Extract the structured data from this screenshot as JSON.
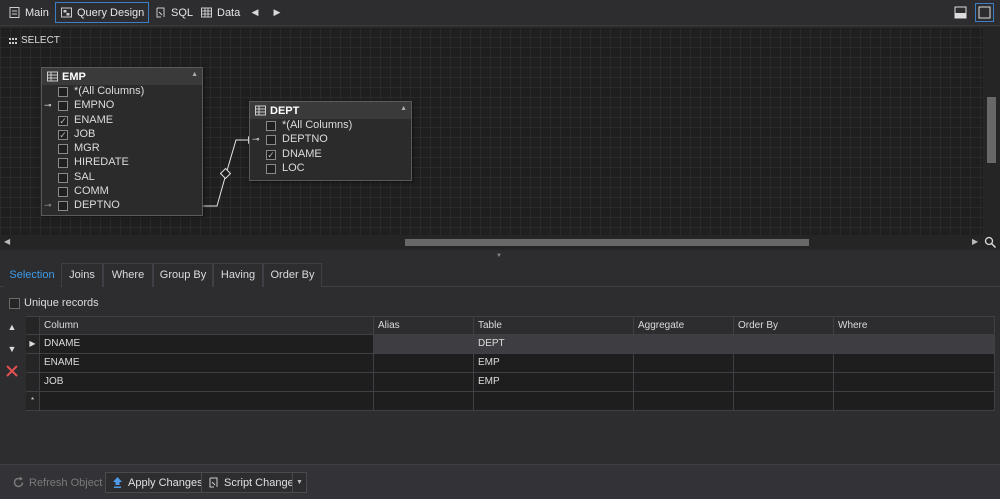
{
  "toolbar": {
    "tabs": [
      {
        "label": "Main",
        "icon": "document-icon"
      },
      {
        "label": "Query Design",
        "icon": "query-design-icon",
        "active": true
      },
      {
        "label": "SQL",
        "icon": "sql-icon"
      },
      {
        "label": "Data",
        "icon": "grid-icon"
      }
    ]
  },
  "designer": {
    "select_label": "SELECT",
    "tables": [
      {
        "name": "EMP",
        "columns": [
          {
            "label": "*(All Columns)",
            "checked": false,
            "key": ""
          },
          {
            "label": "EMPNO",
            "checked": false,
            "key": "primary"
          },
          {
            "label": "ENAME",
            "checked": true,
            "key": ""
          },
          {
            "label": "JOB",
            "checked": true,
            "key": ""
          },
          {
            "label": "MGR",
            "checked": false,
            "key": ""
          },
          {
            "label": "HIREDATE",
            "checked": false,
            "key": ""
          },
          {
            "label": "SAL",
            "checked": false,
            "key": ""
          },
          {
            "label": "COMM",
            "checked": false,
            "key": ""
          },
          {
            "label": "DEPTNO",
            "checked": false,
            "key": "foreign"
          }
        ]
      },
      {
        "name": "DEPT",
        "columns": [
          {
            "label": "*(All Columns)",
            "checked": false,
            "key": ""
          },
          {
            "label": "DEPTNO",
            "checked": false,
            "key": "primary"
          },
          {
            "label": "DNAME",
            "checked": true,
            "key": ""
          },
          {
            "label": "LOC",
            "checked": false,
            "key": ""
          }
        ]
      }
    ]
  },
  "tabs": [
    {
      "label": "Selection",
      "active": true
    },
    {
      "label": "Joins"
    },
    {
      "label": "Where"
    },
    {
      "label": "Group By"
    },
    {
      "label": "Having"
    },
    {
      "label": "Order By"
    }
  ],
  "unique_records": {
    "label": "Unique records",
    "checked": false
  },
  "grid": {
    "columns": [
      "Column",
      "Alias",
      "Table",
      "Aggregate",
      "Order By",
      "Where"
    ],
    "rows": [
      {
        "cells": [
          "DNAME",
          "",
          "DEPT",
          "",
          "",
          ""
        ],
        "selected": true
      },
      {
        "cells": [
          "ENAME",
          "",
          "EMP",
          "",
          "",
          ""
        ],
        "selected": false
      },
      {
        "cells": [
          "JOB",
          "",
          "EMP",
          "",
          "",
          ""
        ],
        "selected": false
      }
    ],
    "new_row_marker": "*"
  },
  "footer": {
    "refresh": "Refresh Object",
    "apply": "Apply Changes",
    "script": "Script Changes"
  },
  "colors": {
    "accent": "#3d9bea",
    "background": "#2d2d30",
    "canvas": "#1f1f1f",
    "delete": "#e05050"
  }
}
